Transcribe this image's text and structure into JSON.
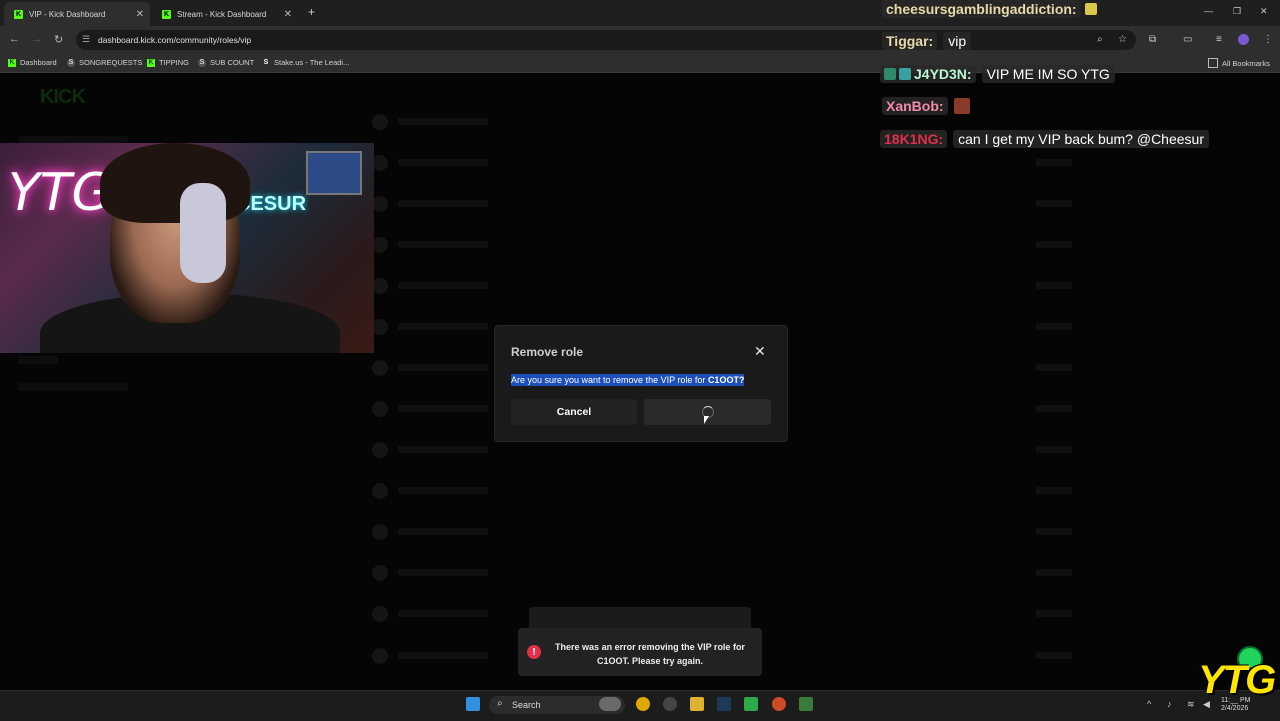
{
  "browser": {
    "tabs": [
      {
        "label": "VIP - Kick Dashboard",
        "active": true
      },
      {
        "label": "Stream - Kick Dashboard",
        "active": false
      }
    ],
    "url": "dashboard.kick.com/community/roles/vip",
    "bookmarks": [
      "Dashboard",
      "SONGREQUESTS",
      "TIPPING",
      "SUB COUNT",
      "Stake.us - The Leadi..."
    ],
    "all_bookmarks": "All Bookmarks"
  },
  "page": {
    "logo_text": "KICK"
  },
  "chat": [
    {
      "user": "cheesursgamblingaddiction:",
      "message": "",
      "user_color": "#e8d9a8"
    },
    {
      "user": "Tiggar:",
      "message": "vip",
      "user_color": "#e8d9a8"
    },
    {
      "user": "J4YD3N:",
      "message": "VIP ME IM SO YTG",
      "user_color": "#b9f7d0"
    },
    {
      "user": "XanBob:",
      "message": "",
      "user_color": "#f28aa8"
    },
    {
      "user": "18K1NG:",
      "message": "can I get my VIP back bum? @Cheesur",
      "user_color": "#e0304a"
    }
  ],
  "webcam": {
    "neon_left": "YTG",
    "neon_right": "CESUR"
  },
  "modal": {
    "title": "Remove role",
    "message_prefix": "Are you sure you want to remove the VIP role for ",
    "message_user": "C1OOT?",
    "cancel_label": "Cancel"
  },
  "toast": {
    "message": "There was an error removing the VIP role for C1OOT. Please try again."
  },
  "taskbar": {
    "search_label": "Search",
    "time": "11:__ PM",
    "date": "2/4/2026"
  },
  "overlay_logo": "YTG",
  "colors": {
    "kick_green": "#53fc18",
    "selection_blue": "#1e4fb8",
    "error_red": "#e0304a"
  }
}
